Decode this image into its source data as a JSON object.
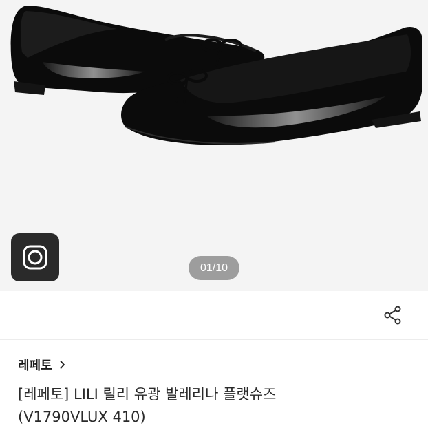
{
  "gallery": {
    "image_alt": "",
    "page_indicator": "01/10",
    "camera_icon": "camera-lens-icon"
  },
  "actions": {
    "share_icon": "share-icon"
  },
  "product": {
    "brand": "레페토",
    "title_line1": "[레페토] LILI 릴리 유광 발레리나 플랫슈즈",
    "title_line2": "(V1790VLUX 410)"
  },
  "colors": {
    "gallery_background": "#f4f4f4",
    "camera_button": "#2a2a2a",
    "indicator_background": "#9d9d9d",
    "shoe": "#0b0b0b"
  }
}
